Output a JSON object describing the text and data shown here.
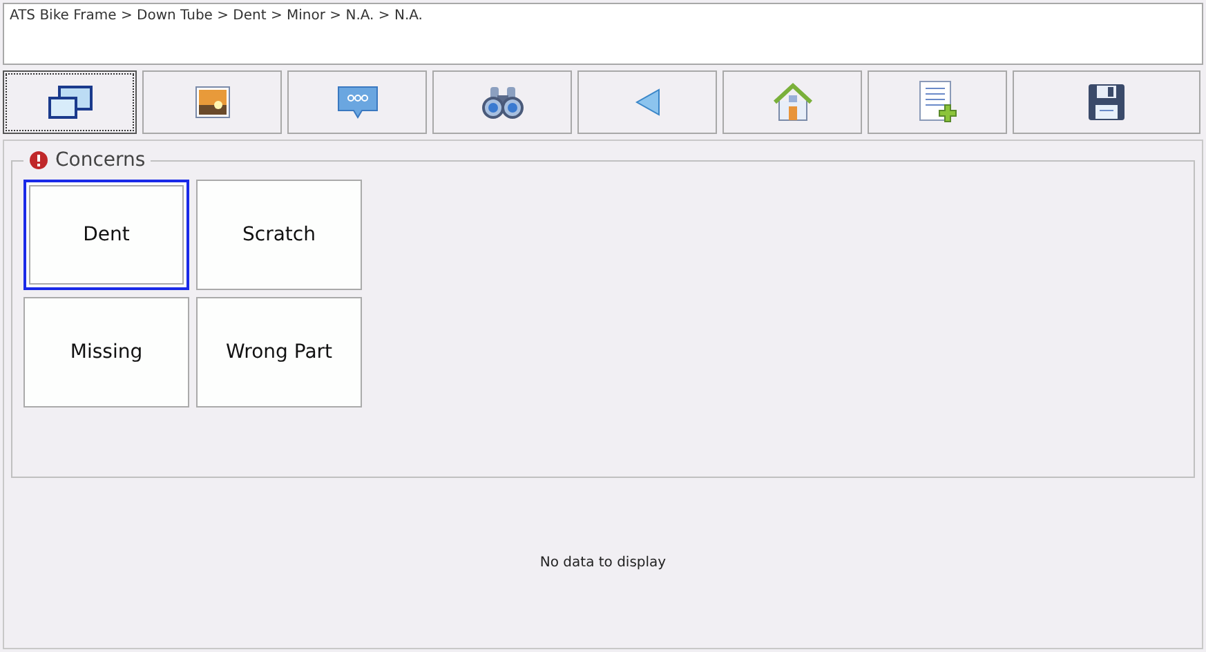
{
  "breadcrumb": "ATS Bike Frame > Down Tube > Dent > Minor > N.A. > N.A.",
  "toolbar": [
    {
      "kind": "windows",
      "focused": true
    },
    {
      "kind": "image",
      "focused": false
    },
    {
      "kind": "comment",
      "focused": false
    },
    {
      "kind": "binoculars",
      "focused": false
    },
    {
      "kind": "back",
      "focused": false
    },
    {
      "kind": "home",
      "focused": false
    },
    {
      "kind": "new-document",
      "focused": false
    },
    {
      "kind": "save",
      "focused": false
    }
  ],
  "group": {
    "title": "Concerns",
    "items": [
      {
        "label": "Dent",
        "selected": true
      },
      {
        "label": "Scratch",
        "selected": false
      },
      {
        "label": "Missing",
        "selected": false
      },
      {
        "label": "Wrong Part",
        "selected": false
      }
    ]
  },
  "empty_message": "No data to display"
}
